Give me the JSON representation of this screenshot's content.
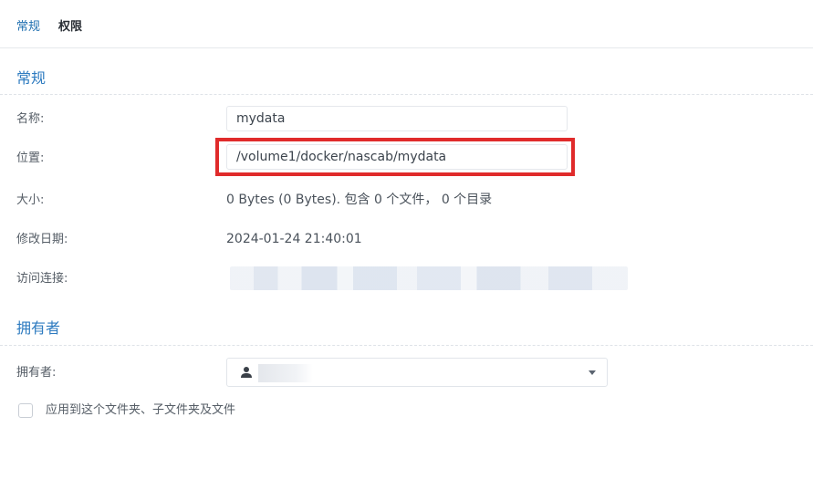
{
  "tabs": [
    {
      "label": "常规",
      "active": true
    },
    {
      "label": "权限",
      "active": false
    }
  ],
  "general": {
    "section_title": "常规",
    "name": {
      "label": "名称:",
      "value": "mydata"
    },
    "location": {
      "label": "位置:",
      "value": "/volume1/docker/nascab/mydata"
    },
    "size": {
      "label": "大小:",
      "value": "0 Bytes (0 Bytes). 包含 0 个文件， 0 个目录"
    },
    "modified": {
      "label": "修改日期:",
      "value": "2024-01-24 21:40:01"
    },
    "access_link": {
      "label": "访问连接:"
    }
  },
  "owner": {
    "section_title": "拥有者",
    "label": "拥有者:",
    "icon": "user-icon"
  },
  "apply_checkbox": {
    "label": "应用到这个文件夹、子文件夹及文件",
    "checked": false
  },
  "colors": {
    "accent": "#2e7bc0",
    "highlight": "#e02b2b"
  }
}
